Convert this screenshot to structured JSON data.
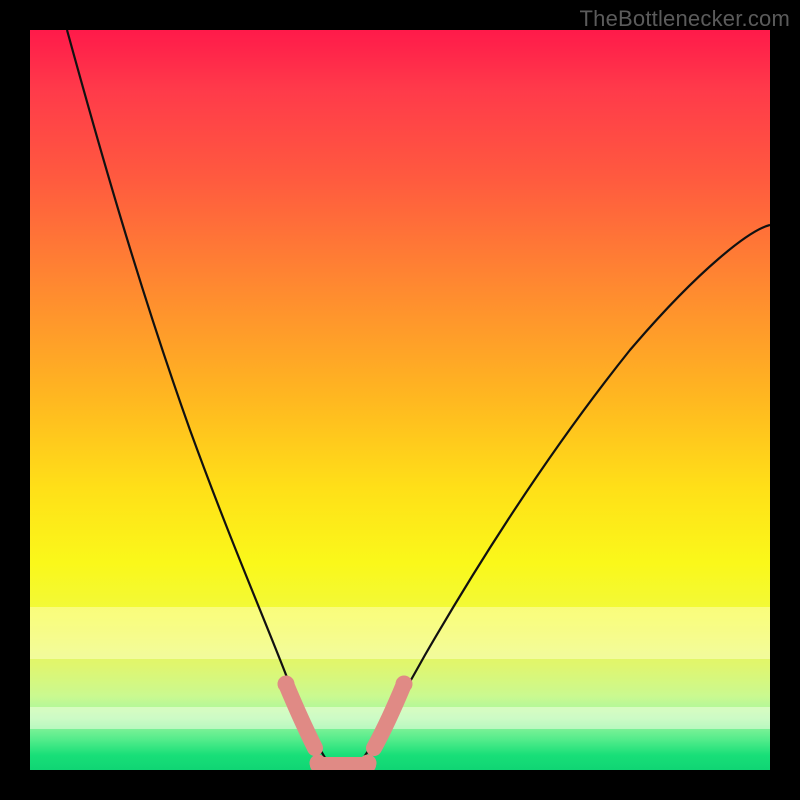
{
  "watermark": "TheBottlenecker.com",
  "chart_data": {
    "type": "line",
    "title": "",
    "xlabel": "",
    "ylabel": "",
    "xlim": [
      0,
      100
    ],
    "ylim": [
      0,
      100
    ],
    "grid": false,
    "legend": false,
    "annotations": [],
    "note": "Axes, ticks, and units are not shown in the source image; values below are plot-space estimates (0–100) read from pixel positions.",
    "series": [
      {
        "name": "left-curve",
        "x": [
          5,
          10,
          15,
          20,
          25,
          30,
          34,
          37,
          39,
          41
        ],
        "y": [
          100,
          78,
          58,
          42,
          28,
          16,
          8,
          3,
          1,
          0
        ]
      },
      {
        "name": "right-curve",
        "x": [
          44,
          46,
          48,
          52,
          58,
          66,
          76,
          88,
          100
        ],
        "y": [
          0,
          1,
          3,
          8,
          18,
          32,
          48,
          62,
          72
        ]
      }
    ],
    "markers": {
      "left_segment": {
        "x_from": 34.5,
        "x_to": 38.5,
        "y_from": 8,
        "y_to": 2
      },
      "right_segment": {
        "x_from": 46.5,
        "x_to": 50.5,
        "y_from": 2,
        "y_to": 8
      },
      "bottom_segment": {
        "x_from": 38.8,
        "x_to": 45.5,
        "y": 0
      }
    },
    "background_gradient": {
      "top": "#ff1a4a",
      "mid": "#ffe018",
      "bottom": "#10d574"
    }
  }
}
